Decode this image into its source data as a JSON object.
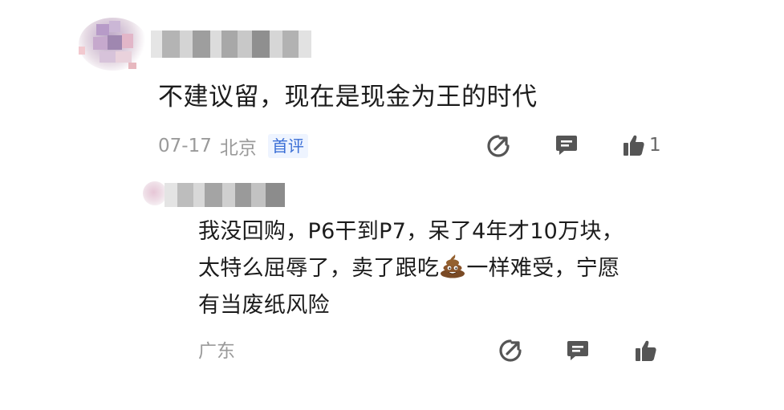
{
  "comment": {
    "text": "不建议留，现在是现金为王的时代",
    "date": "07-17",
    "location": "北京",
    "badge": "首评",
    "like_count": "1"
  },
  "reply": {
    "lines": [
      "我没回购，P6干到P7，呆了4年才10万块，",
      "太特么屈辱了，卖了跟吃",
      "一样难受，宁愿",
      "有当废纸风险"
    ],
    "location": "广东"
  },
  "icons": {
    "share": "share-icon",
    "comment": "comment-icon",
    "like": "thumbs-up-icon",
    "emoji": "poop-emoji"
  },
  "colors": {
    "text": "#1c1c1c",
    "meta": "#9a9a9a",
    "badge_bg": "#eef4ff",
    "badge_text": "#3b6fd6",
    "icon": "#555555"
  }
}
